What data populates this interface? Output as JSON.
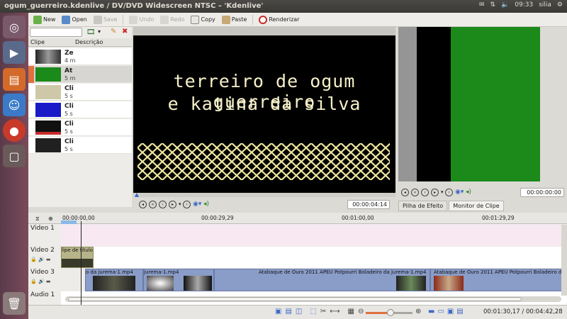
{
  "window": {
    "title": "ogum_guerreiro.kdenlive / DV/DVD Widescreen NTSC – 'Kdenlive'",
    "clock": "09:33",
    "user": "silia"
  },
  "toolbar": {
    "new": "New",
    "open": "Open",
    "save": "Save",
    "undo": "Undo",
    "redo": "Redo",
    "copy": "Copy",
    "paste": "Paste",
    "render": "Renderizar"
  },
  "bin": {
    "col_clip": "Clipe",
    "col_desc": "Descrição",
    "clips": [
      {
        "name": "Ze",
        "duration": "4 m"
      },
      {
        "name": "At",
        "duration": "5 m"
      },
      {
        "name": "Cli",
        "duration": "5 s"
      },
      {
        "name": "Cli",
        "duration": "5 s"
      },
      {
        "name": "Cli",
        "duration": "5 s"
      },
      {
        "name": "Cli",
        "duration": "5 s"
      }
    ]
  },
  "project_monitor": {
    "title_line1": "terreiro de ogum guerreiro",
    "title_line2": "e katina da silva",
    "timecode": "00:00:04:14"
  },
  "clip_monitor": {
    "timecode": "00:00:00:00",
    "tab_effects": "Pilha de Efeito",
    "tab_clip_monitor": "Monitor de Clipe"
  },
  "timeline": {
    "ruler": [
      "00:00:00,00",
      "00:00:29,29",
      "00:01:00,00",
      "00:01:29,29"
    ],
    "tracks": [
      "Video 1",
      "Video 2",
      "Video 3",
      "Audio 1"
    ],
    "clips": {
      "title_clip": "lipe de título",
      "v3a": "o da jurema-1.mp4",
      "v3b": "jurema-1.mp4",
      "v3c": "Atabaque de Ouro 2011 APEU Potpourri Boladeiro da jurema-1.mp4",
      "v3d": "Atabaque de Ouro 2011 APEU Potpourri Boladeiro da jurema-1.mp4"
    }
  },
  "status": {
    "time": "00:01:30,17 / 00:04:42,28"
  }
}
